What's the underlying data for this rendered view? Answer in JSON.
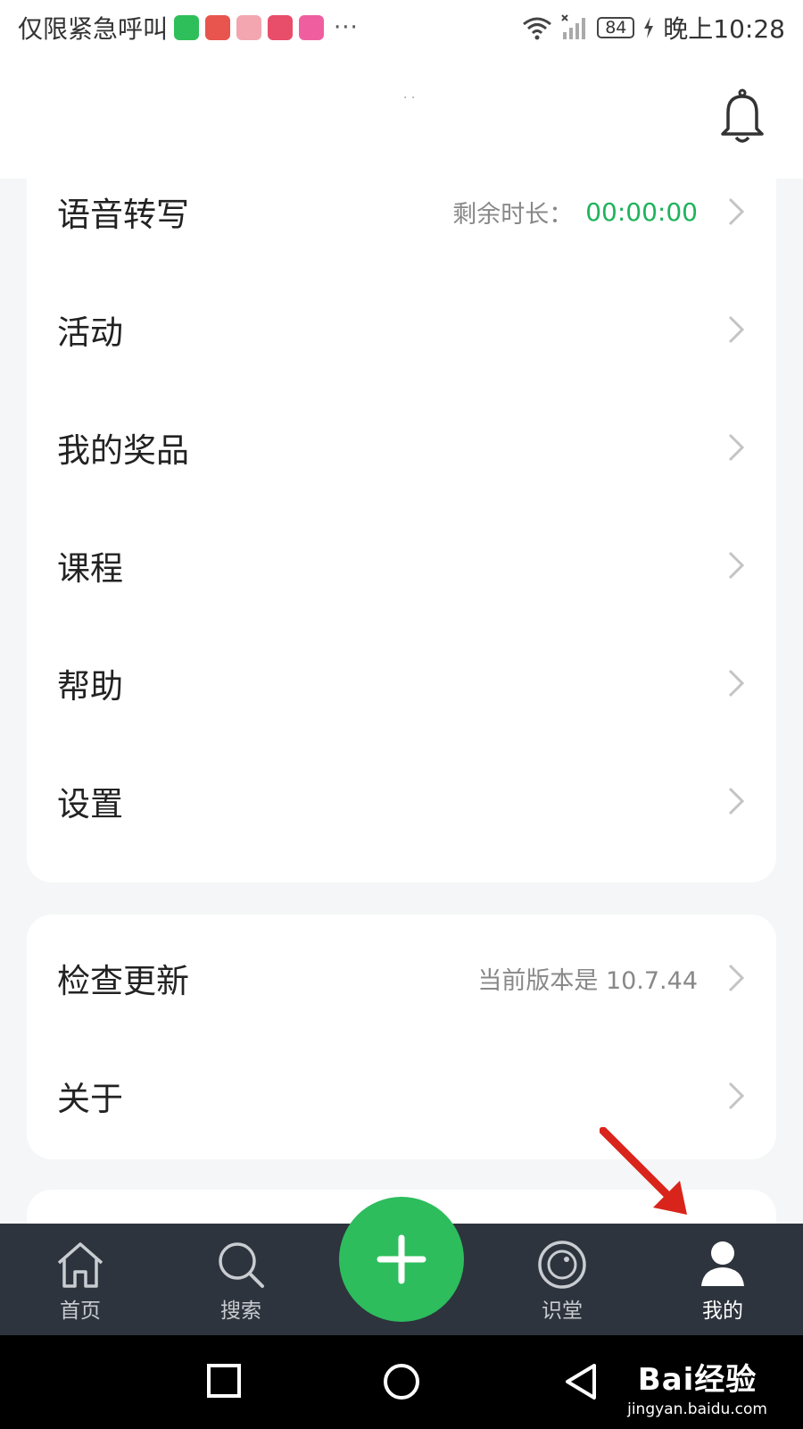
{
  "status_bar": {
    "left_text": "仅限紧急呼叫",
    "app_icons": [
      {
        "name": "reader-app-icon",
        "color": "#2fbf5a"
      },
      {
        "name": "red-app-icon",
        "color": "#e8554e"
      },
      {
        "name": "cartoon-app-icon",
        "color": "#f3a6b0"
      },
      {
        "name": "circle-app-icon",
        "color": "#e84d6a"
      },
      {
        "name": "pink-app-icon",
        "color": "#ef5fa0"
      }
    ],
    "more": "···",
    "battery": "84",
    "time": "晚上10:28"
  },
  "menu_card1": {
    "items": [
      {
        "label": "语音转写",
        "meta": "剩余时长：",
        "value": "00:00:00"
      },
      {
        "label": "活动"
      },
      {
        "label": "我的奖品"
      },
      {
        "label": "课程"
      },
      {
        "label": "帮助"
      },
      {
        "label": "设置"
      }
    ]
  },
  "menu_card2": {
    "items": [
      {
        "label": "检查更新",
        "meta": "当前版本是 10.7.44"
      },
      {
        "label": "关于"
      }
    ]
  },
  "tabbar": {
    "tabs": [
      {
        "label": "首页",
        "icon": "home-icon"
      },
      {
        "label": "搜索",
        "icon": "search-icon"
      },
      {
        "label": "识堂",
        "icon": "smile-icon"
      },
      {
        "label": "我的",
        "icon": "user-icon",
        "active": true
      }
    ],
    "fab_icon": "plus-icon"
  },
  "colors": {
    "accent_green": "#2dbd5d",
    "value_green": "#1fb35c",
    "tabbar_bg": "#2d343d",
    "arrow_red": "#d9241c"
  },
  "watermark": {
    "main": "Bai经验",
    "sub": "jingyan.baidu.com"
  }
}
